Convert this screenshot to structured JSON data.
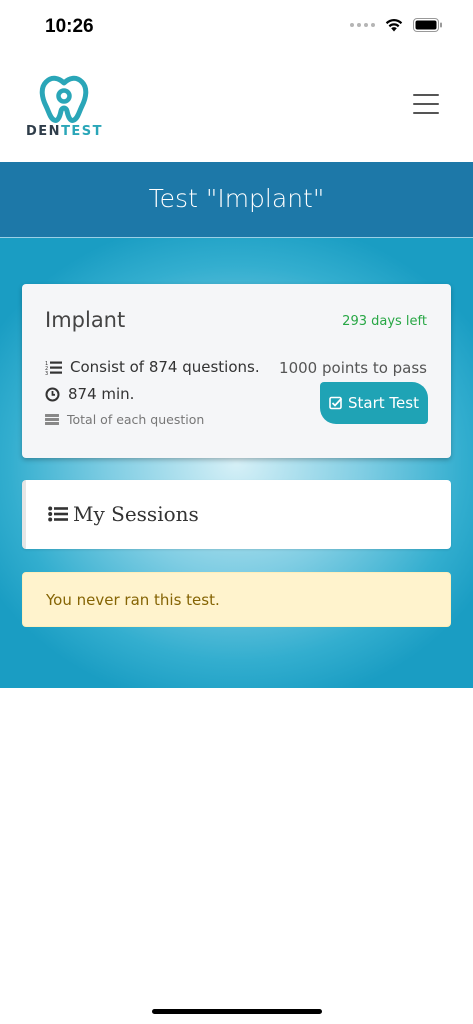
{
  "status_bar": {
    "time": "10:26",
    "icons": [
      "signal-dots",
      "wifi-icon",
      "battery-icon"
    ]
  },
  "header": {
    "logo": {
      "text_part1": "DEN",
      "text_part2": "TEST",
      "accent_color": "#2aa6b8"
    },
    "menu_icon": "hamburger-icon"
  },
  "title_bar": {
    "title": "Test \"Implant\"",
    "background": "#1d78a8"
  },
  "test_card": {
    "name": "Implant",
    "days_left": "293 days left",
    "questions_text": "Consist of 874 questions.",
    "duration_text": "874 min.",
    "total_text": "Total of each question",
    "points_text": "1000 points to pass",
    "start_button_label": "Start Test",
    "button_color": "#1fa3b5",
    "days_left_color": "#28a745"
  },
  "sessions": {
    "title": "My Sessions",
    "icon": "list-icon"
  },
  "alert": {
    "message": "You never ran this test.",
    "background": "#fff3cd"
  }
}
